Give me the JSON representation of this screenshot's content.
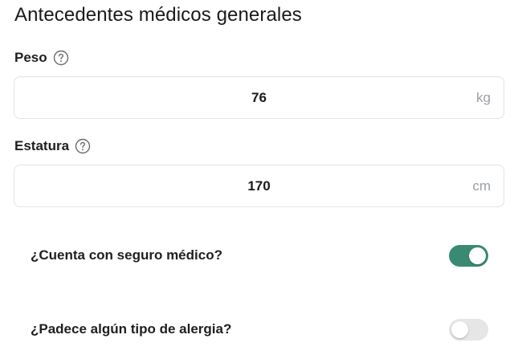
{
  "section": {
    "title": "Antecedentes médicos generales"
  },
  "weight": {
    "label": "Peso",
    "value": "76",
    "unit": "kg",
    "help_icon": "question-circle-icon"
  },
  "height": {
    "label": "Estatura",
    "value": "170",
    "unit": "cm",
    "help_icon": "question-circle-icon"
  },
  "insurance": {
    "label": "¿Cuenta con seguro médico?",
    "enabled": true
  },
  "allergy": {
    "label": "¿Padece algún tipo de alergia?",
    "enabled": false
  },
  "colors": {
    "toggle_on": "#3a8a73",
    "toggle_off": "#e6e6e6",
    "unit_text": "#9aa0a6",
    "input_border": "#dfe3e8"
  }
}
